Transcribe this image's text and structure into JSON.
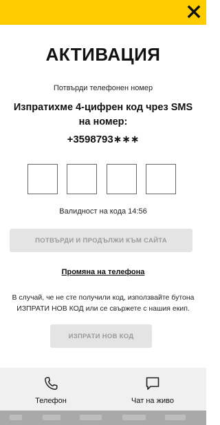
{
  "header": {
    "close_icon": "close-icon",
    "accent_color": "#ffcc00"
  },
  "activation": {
    "title": "АКТИВАЦИЯ",
    "subtitle": "Потвърди телефонен номер",
    "sent_message": "Изпратихме 4-цифрен код чрез SMS на номер:",
    "phone_number": "+3598793∗∗∗",
    "code_digits": [
      "",
      "",
      "",
      ""
    ],
    "validity": "Валидност на кода 14:56",
    "confirm_button": "ПОТВЪРДИ И ПРОДЪЛЖИ КЪМ САЙТА",
    "change_phone_link": "Промяна на телефона",
    "help_text": "В случай, че не сте получили код, използвайте бутона ИЗПРАТИ НОВ КОД или се свържете с нашия екип.",
    "resend_button": "ИЗПРАТИ НОВ КОД"
  },
  "bottom_bar": {
    "items": [
      {
        "label": "Телефон",
        "icon": "phone-icon"
      },
      {
        "label": "Чат на живо",
        "icon": "chat-icon"
      }
    ]
  }
}
